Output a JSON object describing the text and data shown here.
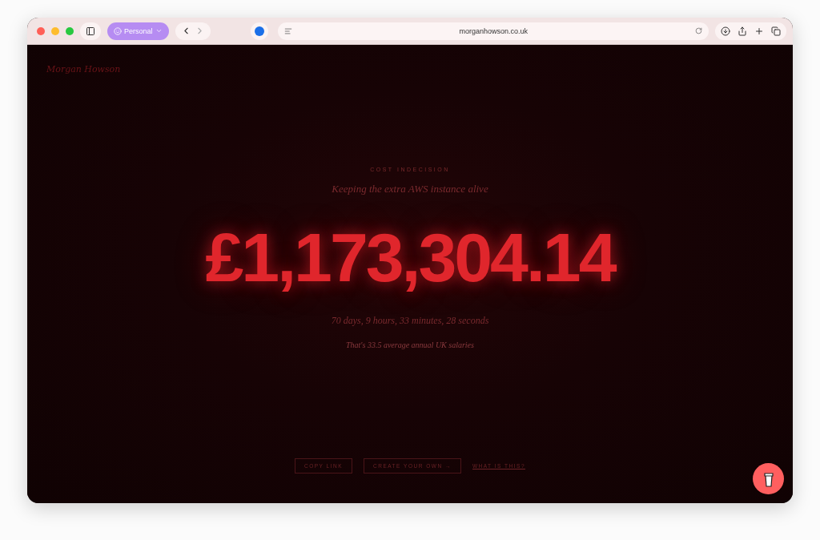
{
  "browser": {
    "profile": "Personal",
    "url": "morganhowson.co.uk"
  },
  "site": {
    "logo": "Morgan Howson",
    "eyebrow": "COST INDECISION",
    "subtitle": "Keeping the extra AWS instance alive",
    "amount": "£1,173,304.14",
    "duration": "70 days, 9 hours, 33 minutes, 28 seconds",
    "comparison": "That's 33.5 average annual UK salaries"
  },
  "actions": [
    {
      "label": "COPY LINK",
      "kind": "outlined"
    },
    {
      "label": "CREATE YOUR OWN →",
      "kind": "outlined"
    },
    {
      "label": "WHAT IS THIS?",
      "kind": "link"
    }
  ]
}
